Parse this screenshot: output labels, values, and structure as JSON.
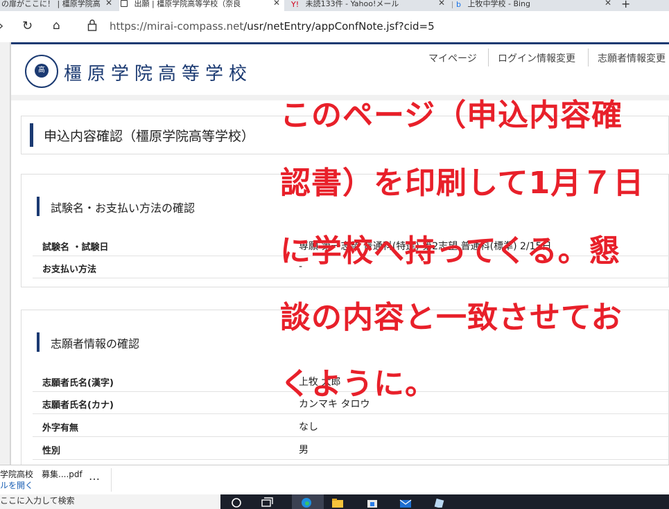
{
  "browser": {
    "tabs": [
      {
        "title": "の扉がここに！ | 橿原学院高"
      },
      {
        "title": "出願 | 橿原学院高等学校（奈良"
      },
      {
        "title": "未読133件 - Yahoo!メール"
      },
      {
        "title": "上牧中学校 - Bing"
      }
    ],
    "url_host": "https://mirai-compass.net",
    "url_path": "/usr/netEntry/appConfNote.jsf?cid=5"
  },
  "site": {
    "school_name": "橿原学院高等学校",
    "logo_text": "高",
    "nav": [
      "マイページ",
      "ログイン情報変更",
      "志願者情報変更"
    ]
  },
  "main": {
    "page_title": "申込内容確認（橿原学院高等学校）",
    "section1": {
      "title": "試験名・お支払い方法の確認",
      "rows": [
        {
          "label": "試験名 ・試験日",
          "value": "専願 第一志望 普通科(特進) 第2志望 普通科(標準)   2/15日"
        },
        {
          "label": "お支払い方法",
          "value": "-"
        }
      ]
    },
    "section2": {
      "title": "志願者情報の確認",
      "rows": [
        {
          "label": "志願者氏名(漢字)",
          "value": "上牧 太郎"
        },
        {
          "label": "志願者氏名(カナ)",
          "value": "カンマキ タロウ"
        },
        {
          "label": "外字有無",
          "value": "なし"
        },
        {
          "label": "性別",
          "value": "男"
        }
      ]
    }
  },
  "annotation": {
    "lines": [
      "このページ（申込内容確",
      "認書）を印刷して1月７日",
      "に学校へ持ってくる。懇",
      "談の内容と一致させてお",
      "くように。"
    ],
    "color": "#e8202a"
  },
  "download": {
    "file_name": "学院高校　募集....pdf",
    "open_label": "ルを開く",
    "more": "…"
  },
  "taskbar": {
    "search_placeholder": "ここに入力して検索"
  },
  "colors": {
    "brand": "#1b3a72",
    "annotation": "#e8202a"
  }
}
